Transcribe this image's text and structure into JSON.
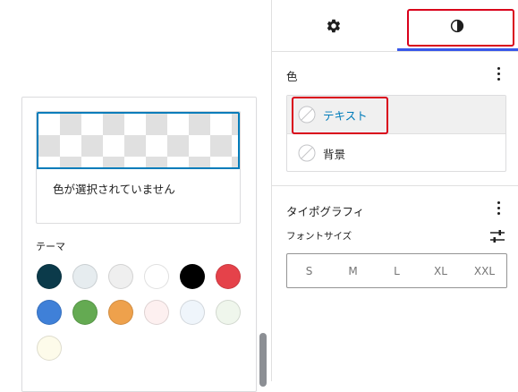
{
  "popover": {
    "no_color_text": "色が選択されていません",
    "theme_label": "テーマ",
    "palette": [
      {
        "name": "palette-color-dark-teal",
        "color": "#0b3a4a"
      },
      {
        "name": "palette-color-light-gray-blue",
        "color": "#e6ecef"
      },
      {
        "name": "palette-color-light-gray",
        "color": "#efefef"
      },
      {
        "name": "palette-color-white",
        "color": "#ffffff"
      },
      {
        "name": "palette-color-black",
        "color": "#000000"
      },
      {
        "name": "palette-color-red",
        "color": "#e5424a"
      },
      {
        "name": "palette-color-blue",
        "color": "#3f80d8"
      },
      {
        "name": "palette-color-green",
        "color": "#64aa52"
      },
      {
        "name": "palette-color-orange",
        "color": "#eea14c"
      },
      {
        "name": "palette-color-pale-pink",
        "color": "#fdf0f0"
      },
      {
        "name": "palette-color-pale-blue",
        "color": "#eff5fb"
      },
      {
        "name": "palette-color-pale-green",
        "color": "#eff6ec"
      },
      {
        "name": "palette-color-cream",
        "color": "#fdfbea"
      }
    ]
  },
  "sidebar": {
    "tabs": [
      {
        "name": "settings",
        "icon": "gear-icon"
      },
      {
        "name": "styles",
        "icon": "half-circle-contrast-icon",
        "active": true
      }
    ],
    "color_panel": {
      "title": "色",
      "items": [
        {
          "label": "テキスト",
          "active": true
        },
        {
          "label": "背景",
          "active": false
        }
      ]
    },
    "typography_panel": {
      "title": "タイポグラフィ",
      "font_size_label": "フォントサイズ",
      "sizes": [
        "S",
        "M",
        "L",
        "XL",
        "XXL"
      ]
    }
  },
  "colors": {
    "accent": "#3858e9",
    "link_blue": "#007cba",
    "highlight_red": "#d9001b"
  }
}
